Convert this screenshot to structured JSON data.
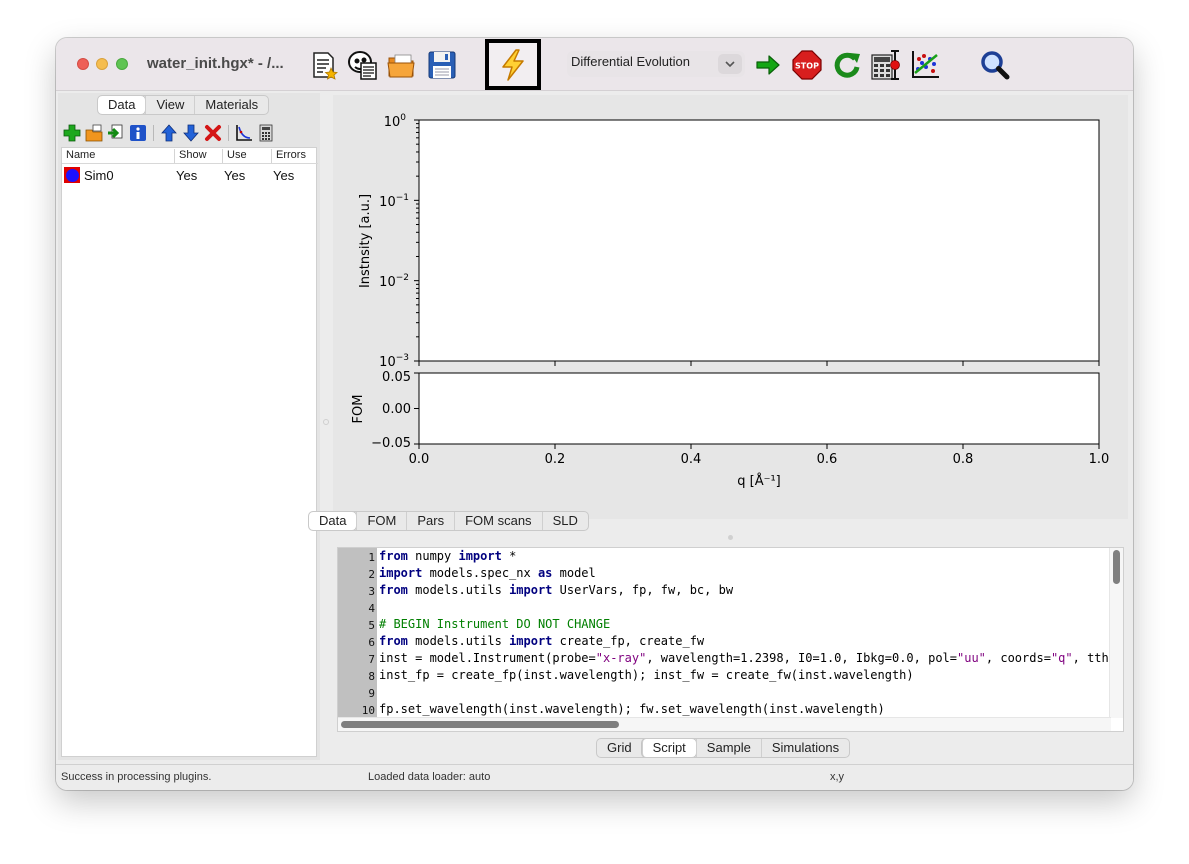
{
  "window": {
    "title": "water_init.hgx* - /..."
  },
  "toolbar": {
    "icons": [
      "new-model-icon",
      "new-from-file-icon",
      "open-file-icon",
      "save-file-icon",
      "auto-simulate-lightning-icon",
      "start-fit-arrow-icon",
      "stop-icon",
      "restart-fit-icon",
      "calculate-errors-icon",
      "project-fom-icon",
      "zoom-magnifier-icon"
    ],
    "algorithm": {
      "selected": "Differential Evolution"
    }
  },
  "left_panel": {
    "tabs": [
      "Data",
      "View",
      "Materials"
    ],
    "active_tab": "Data",
    "toolbar_icons": [
      "add-dataset-icon",
      "import-data-icon",
      "import-multiple-icon",
      "dataset-info-icon",
      "move-up-icon",
      "move-down-icon",
      "delete-dataset-icon",
      "plot-settings-icon",
      "calculator-icon"
    ],
    "columns": [
      "Name",
      "Show",
      "Use",
      "Errors"
    ],
    "rows": [
      {
        "name": "Sim0",
        "show": "Yes",
        "use": "Yes",
        "errors": "Yes",
        "color": "#1c10ff",
        "edge_color": "#e00000"
      }
    ]
  },
  "plot": {
    "tabs": [
      "Data",
      "FOM",
      "Pars",
      "FOM scans",
      "SLD"
    ],
    "active_tab": "Data"
  },
  "chart_data": [
    {
      "type": "line",
      "title": "",
      "xlabel": "",
      "ylabel": "Instnsity [a.u.]",
      "yscale": "log",
      "xlim": [
        0.0,
        1.0
      ],
      "ylim": [
        0.001,
        1.0
      ],
      "y_ticks": [
        {
          "value": 1,
          "label_base": "10",
          "label_exp": "0"
        },
        {
          "value": 0.1,
          "label_base": "10",
          "label_exp": "−1"
        },
        {
          "value": 0.01,
          "label_base": "10",
          "label_exp": "−2"
        },
        {
          "value": 0.001,
          "label_base": "10",
          "label_exp": "−3"
        }
      ],
      "series": []
    },
    {
      "type": "line",
      "title": "",
      "xlabel": "q [Å⁻¹]",
      "ylabel": "FOM",
      "xlim": [
        0.0,
        1.0
      ],
      "ylim": [
        -0.05,
        0.05
      ],
      "x_ticks": [
        "0.0",
        "0.2",
        "0.4",
        "0.6",
        "0.8",
        "1.0"
      ],
      "y_ticks": [
        "0.05",
        "0.00",
        "−0.05"
      ],
      "series": []
    }
  ],
  "editor": {
    "line_numbers": [
      "1",
      "2",
      "3",
      "4",
      "5",
      "6",
      "7",
      "8",
      "9",
      "10"
    ]
  },
  "bottom_tabs": {
    "tabs": [
      "Grid",
      "Script",
      "Sample",
      "Simulations"
    ],
    "active_tab": "Script"
  },
  "status": {
    "message": "Success in processing plugins.",
    "loader": "Loaded data loader: auto",
    "coords": "x,y"
  }
}
